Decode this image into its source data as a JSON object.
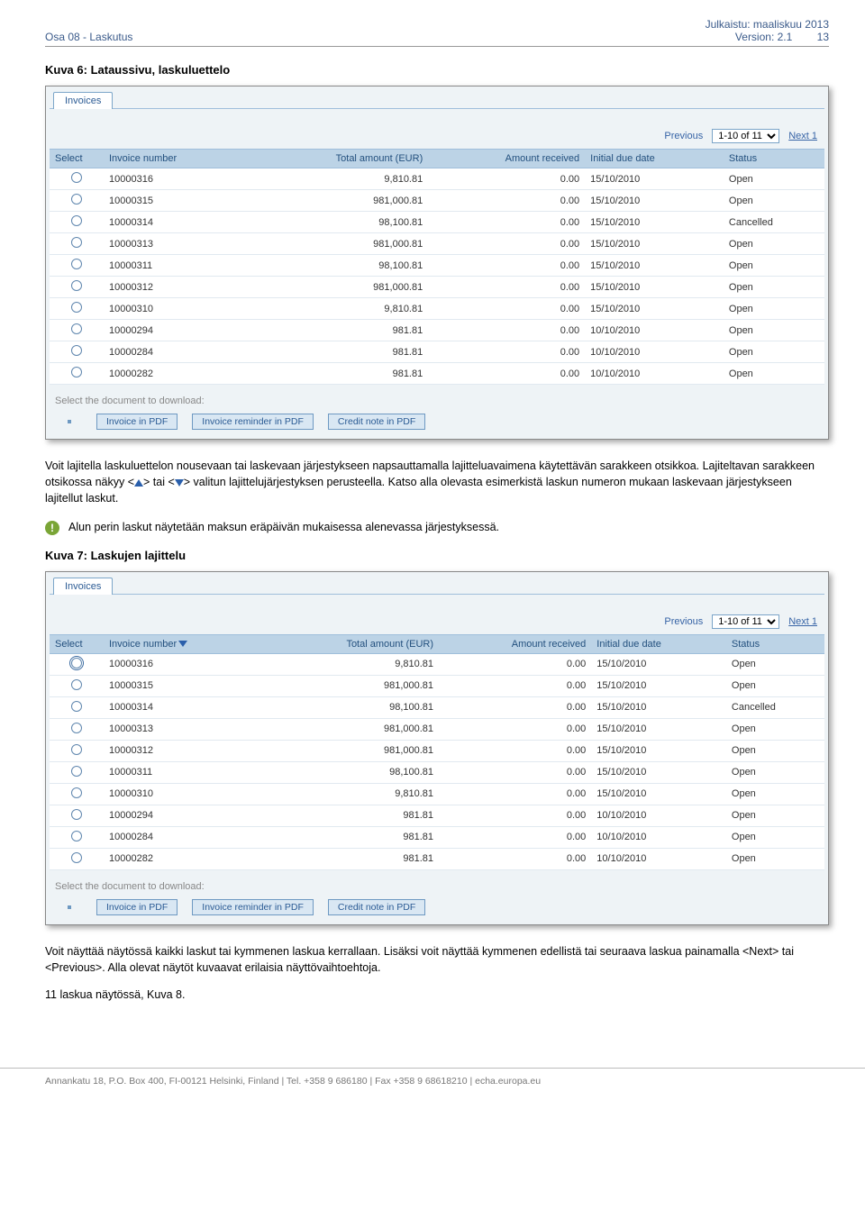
{
  "header": {
    "left": "Osa 08 - Laskutus",
    "published": "Julkaistu: maaliskuu 2013",
    "version": "Version: 2.1",
    "page_no": "13"
  },
  "sections": {
    "kuva6_title": "Kuva 6: Lataussivu, laskuluettelo",
    "para1": "Voit lajitella laskuluettelon nousevaan tai laskevaan järjestykseen napsauttamalla lajitteluavaimena käytettävän sarakkeen otsikkoa. Lajiteltavan sarakkeen otsikossa näkyy <",
    "para1b": "> tai <",
    "para1c": "> valitun lajittelujärjestyksen perusteella. Katso alla olevasta esimerkistä laskun numeron mukaan laskevaan järjestykseen lajitellut laskut.",
    "note": "Alun perin laskut näytetään maksun eräpäivän mukaisessa alenevassa järjestyksessä.",
    "kuva7_title": "Kuva 7: Laskujen lajittelu",
    "para2a": "Voit näyttää näytössä kaikki laskut tai kymmenen laskua kerrallaan. Lisäksi voit näyttää kymmenen edellistä tai seuraava laskua painamalla <Next> tai <Previous>. Alla olevat näytöt kuvaavat erilaisia näyttövaihtoehtoja.",
    "para3": "11 laskua näytössä, Kuva 8."
  },
  "shot": {
    "tab": "Invoices",
    "pager_prev": "Previous",
    "pager_range": "1-10 of 11",
    "pager_next": "Next 1",
    "th_select": "Select",
    "th_invno": "Invoice number",
    "th_total": "Total amount (EUR)",
    "th_recv": "Amount received",
    "th_due": "Initial due date",
    "th_status": "Status",
    "dl_label": "Select the document to download:",
    "btn_inv": "Invoice in PDF",
    "btn_rem": "Invoice reminder in PDF",
    "btn_credit": "Credit note in PDF"
  },
  "rows1": [
    {
      "no": "10000316",
      "total": "9,810.81",
      "recv": "0.00",
      "due": "15/10/2010",
      "st": "Open"
    },
    {
      "no": "10000315",
      "total": "981,000.81",
      "recv": "0.00",
      "due": "15/10/2010",
      "st": "Open"
    },
    {
      "no": "10000314",
      "total": "98,100.81",
      "recv": "0.00",
      "due": "15/10/2010",
      "st": "Cancelled"
    },
    {
      "no": "10000313",
      "total": "981,000.81",
      "recv": "0.00",
      "due": "15/10/2010",
      "st": "Open"
    },
    {
      "no": "10000311",
      "total": "98,100.81",
      "recv": "0.00",
      "due": "15/10/2010",
      "st": "Open"
    },
    {
      "no": "10000312",
      "total": "981,000.81",
      "recv": "0.00",
      "due": "15/10/2010",
      "st": "Open"
    },
    {
      "no": "10000310",
      "total": "9,810.81",
      "recv": "0.00",
      "due": "15/10/2010",
      "st": "Open"
    },
    {
      "no": "10000294",
      "total": "981.81",
      "recv": "0.00",
      "due": "10/10/2010",
      "st": "Open"
    },
    {
      "no": "10000284",
      "total": "981.81",
      "recv": "0.00",
      "due": "10/10/2010",
      "st": "Open"
    },
    {
      "no": "10000282",
      "total": "981.81",
      "recv": "0.00",
      "due": "10/10/2010",
      "st": "Open"
    }
  ],
  "rows2": [
    {
      "no": "10000316",
      "total": "9,810.81",
      "recv": "0.00",
      "due": "15/10/2010",
      "st": "Open"
    },
    {
      "no": "10000315",
      "total": "981,000.81",
      "recv": "0.00",
      "due": "15/10/2010",
      "st": "Open"
    },
    {
      "no": "10000314",
      "total": "98,100.81",
      "recv": "0.00",
      "due": "15/10/2010",
      "st": "Cancelled"
    },
    {
      "no": "10000313",
      "total": "981,000.81",
      "recv": "0.00",
      "due": "15/10/2010",
      "st": "Open"
    },
    {
      "no": "10000312",
      "total": "981,000.81",
      "recv": "0.00",
      "due": "15/10/2010",
      "st": "Open"
    },
    {
      "no": "10000311",
      "total": "98,100.81",
      "recv": "0.00",
      "due": "15/10/2010",
      "st": "Open"
    },
    {
      "no": "10000310",
      "total": "9,810.81",
      "recv": "0.00",
      "due": "15/10/2010",
      "st": "Open"
    },
    {
      "no": "10000294",
      "total": "981.81",
      "recv": "0.00",
      "due": "10/10/2010",
      "st": "Open"
    },
    {
      "no": "10000284",
      "total": "981.81",
      "recv": "0.00",
      "due": "10/10/2010",
      "st": "Open"
    },
    {
      "no": "10000282",
      "total": "981.81",
      "recv": "0.00",
      "due": "10/10/2010",
      "st": "Open"
    }
  ],
  "footer": "Annankatu 18, P.O. Box 400, FI-00121 Helsinki, Finland | Tel. +358 9 686180 | Fax +358 9 68618210 | echa.europa.eu"
}
